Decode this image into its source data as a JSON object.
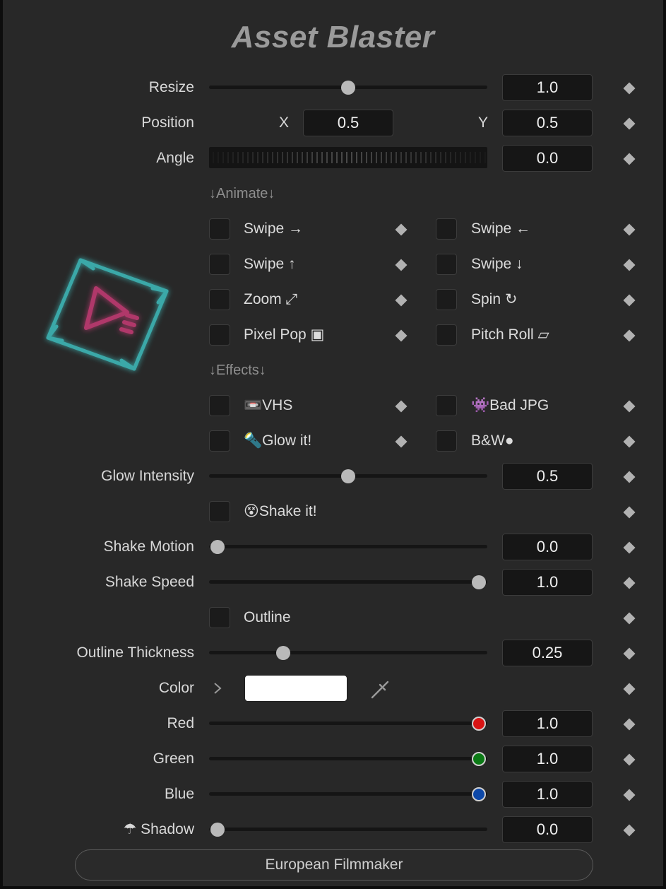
{
  "title": "Asset Blaster",
  "controls": {
    "resize": {
      "label": "Resize",
      "value": "1.0",
      "level": 0.5
    },
    "position": {
      "label": "Position",
      "x_label": "X",
      "x_value": "0.5",
      "y_label": "Y",
      "y_value": "0.5"
    },
    "angle": {
      "label": "Angle",
      "value": "0.0"
    },
    "glow_intensity": {
      "label": "Glow Intensity",
      "value": "0.5",
      "level": 0.5
    },
    "shake_motion": {
      "label": "Shake Motion",
      "value": "0.0",
      "level": 0.0
    },
    "shake_speed": {
      "label": "Shake Speed",
      "value": "1.0",
      "level": 1.0
    },
    "outline_thickness": {
      "label": "Outline Thickness",
      "value": "0.25",
      "level": 0.25
    },
    "color": {
      "label": "Color",
      "expander_icon": "chevron-right-icon",
      "swatch_color": "#ffffff",
      "picker_icon": "eyedropper-icon"
    },
    "red": {
      "label": "Red",
      "value": "1.0",
      "level": 1.0,
      "knob_color": "#d81414"
    },
    "green": {
      "label": "Green",
      "value": "1.0",
      "level": 1.0,
      "knob_color": "#0c7a16"
    },
    "blue": {
      "label": "Blue",
      "value": "1.0",
      "level": 1.0,
      "knob_color": "#0d48a8"
    },
    "shadow": {
      "label": "☂ Shadow",
      "value": "0.0",
      "level": 0.0
    }
  },
  "animate": {
    "header": "↓Animate↓",
    "options": [
      {
        "label": "Swipe →",
        "checked": false
      },
      {
        "label": "Swipe ←",
        "checked": false
      },
      {
        "label": "Swipe ↑",
        "checked": false
      },
      {
        "label": "Swipe ↓",
        "checked": false
      },
      {
        "label": "Zoom ⤢",
        "checked": false
      },
      {
        "label": "Spin ↻",
        "checked": false
      },
      {
        "label": "Pixel Pop ▣",
        "checked": false
      },
      {
        "label": "Pitch Roll ▱",
        "checked": false
      }
    ]
  },
  "effects": {
    "header": "↓Effects↓",
    "options": [
      {
        "label": "📼VHS",
        "checked": false
      },
      {
        "label": "👾Bad JPG",
        "checked": false
      },
      {
        "label": "🔦Glow it!",
        "checked": false
      },
      {
        "label": "B&W●",
        "checked": false
      }
    ]
  },
  "shake_it": {
    "label": "😵Shake it!",
    "checked": false
  },
  "outline": {
    "label": "Outline",
    "checked": false
  },
  "footer": {
    "label": "European Filmmaker"
  },
  "colors": {
    "panel": "#282828",
    "logo_frame": "#3aa8a8",
    "logo_play": "#b0386a"
  }
}
